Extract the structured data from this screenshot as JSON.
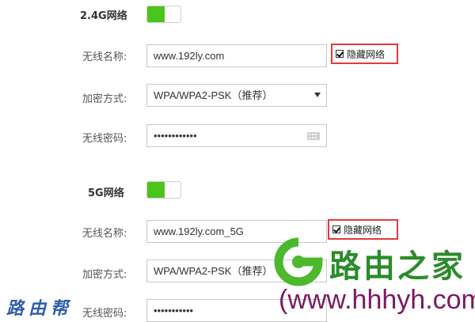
{
  "wifi24": {
    "title": "2.4G网络",
    "toggle_on": true,
    "ssid_label": "无线名称:",
    "ssid_value": "www.192ly.com",
    "hide_label": "隐藏网络",
    "hide_checked": true,
    "encrypt_label": "加密方式:",
    "encrypt_value": "WPA/WPA2-PSK（推荐）",
    "password_label": "无线密码:",
    "password_value": "••••••••••••"
  },
  "wifi5": {
    "title": "5G网络",
    "toggle_on": true,
    "ssid_label": "无线名称:",
    "ssid_value": "www.192ly.com_5G",
    "hide_label": "隐藏网络",
    "hide_checked": true,
    "encrypt_label": "加密方式:",
    "encrypt_value": "WPA/WPA2-PSK（推荐）",
    "password_label": "无线密码:",
    "password_value": "•••••••••••"
  },
  "watermark": {
    "brand": "路由之家",
    "url": "(www.hhhyh.com)",
    "left_mark": "路由帮"
  },
  "colors": {
    "toggle_green": "#4cc41c",
    "highlight_red": "#e23a3a",
    "brand_green": "#2a8c2a",
    "url_purple": "#7a1a62"
  }
}
